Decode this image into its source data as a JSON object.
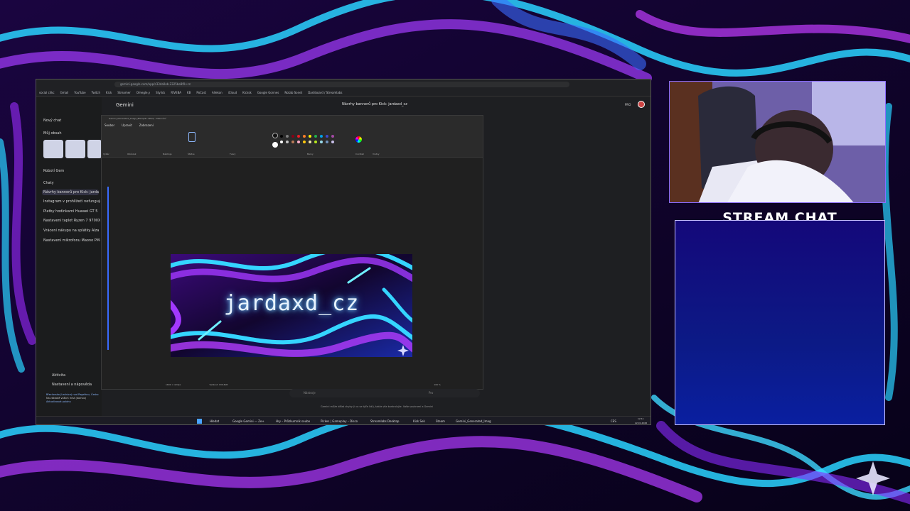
{
  "browser": {
    "url": "gemini.google.com/app/c33da0eb.2325be8f0+cz",
    "bookmarks": [
      "social clikc",
      "Gmail",
      "YouTube",
      "Twitch",
      "Kick",
      "Streamer",
      "Omegle.y",
      "Stylick",
      "RIVEBA",
      "KB",
      "PoCast",
      "Allekon",
      "iCloud",
      "Kicksk",
      "Google Gonnes",
      "Notab Sonet",
      "Dashboard / Streamlabs"
    ]
  },
  "gemini": {
    "title": "Gemini",
    "conversation_title": "Návrhy bannerů pro Kick: jardaxd_cz",
    "pro_label": "PRO",
    "sidebar": {
      "new_chat": "Nový chat",
      "my_content": "Můj obsah",
      "gem": "Robotí Gem",
      "chats_header": "Chaty",
      "chats": [
        "Návrhy bannerů pro Kick: jardaxd_cz",
        "Instagram v prohlížeči nefunguje",
        "Platby hodinkami Huawei GT 5",
        "Nastavení taplot Ryzen 7 9700X 8X",
        "Vrácení nákupu na splátky Alza",
        "Nastavení mikrofonu Maono PM-42"
      ],
      "activity": "Aktivita",
      "settings": "Nastavení a nápověda",
      "notice_line1": "Břeclavsko (Lednice) nad Pagelkou, Česko",
      "notice_line2": "Na základě vašich míst (domov)",
      "notice_line3": "Aktualizovat polohu"
    },
    "input_placeholder": "Nástroje",
    "input_mode": "Pro",
    "disclaimer": "Gemini může dělat chyby (i co se týče lidí), takže vše kontrolujte. Vaše soukromí a Gemini"
  },
  "paint": {
    "window_title": "Gemini_Generated_Image_8fwrq28...8fwrq - Malování",
    "menu": [
      "Soubor",
      "Upravit",
      "Zobrazení"
    ],
    "ribbon_labels": [
      "Výběr",
      "Obrázek",
      "Nástroje",
      "Štětce",
      "Tvary",
      "Barvy",
      "Cocktail",
      "Vrstvy"
    ],
    "status_size": "1600 × 424px",
    "status_filesize": "Velikost: 936.6kB",
    "zoom": "100 %",
    "banner_text": "jardaxd_cz"
  },
  "taskbar": {
    "items": [
      "Hledat",
      "Google Gemini — Ze+",
      "Hry – Průzkumník soubo",
      "Pickes | Gameplay – Disco",
      "Streamlabs Desktop",
      "Kick Sek",
      "Steam",
      "Gemini_Generated_Imag"
    ],
    "lang": "CES",
    "time": "12:11",
    "date": "22.01.2026"
  },
  "overlay": {
    "chat_title": "STREAM CHAT"
  },
  "colors": {
    "accent": "#8a6cff",
    "chat_bg": "#0c1a86",
    "neon_blue": "#3fd8ff",
    "neon_purple": "#b03cff"
  }
}
